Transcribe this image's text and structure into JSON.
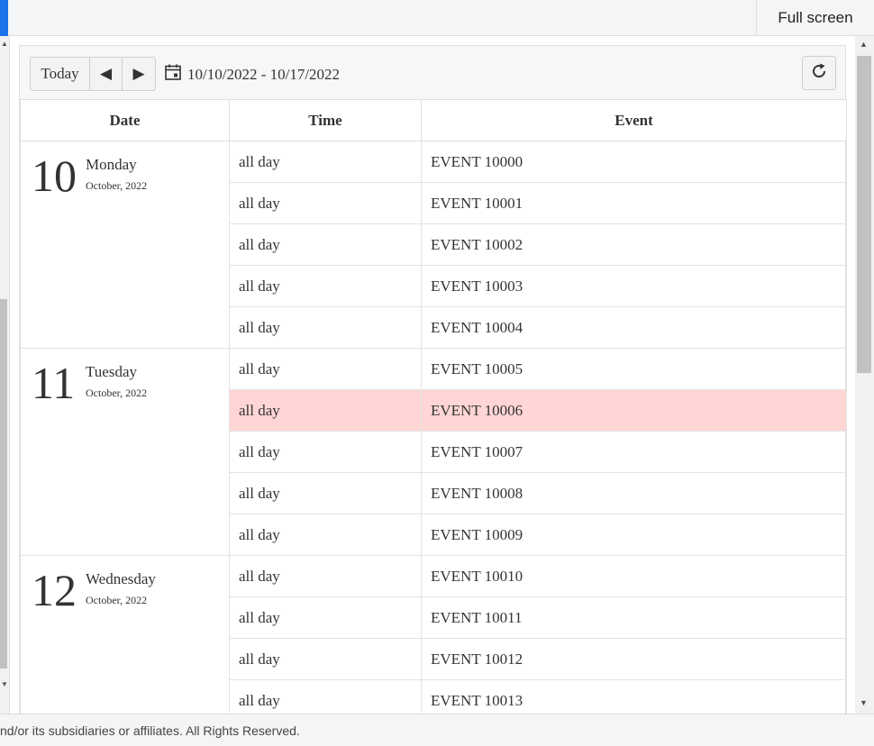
{
  "header": {
    "fullscreen_label": "Full screen"
  },
  "toolbar": {
    "today_label": "Today",
    "prev_icon": "◀",
    "next_icon": "▶",
    "date_range": "10/10/2022 - 10/17/2022"
  },
  "table": {
    "columns": [
      "Date",
      "Time",
      "Event"
    ],
    "days": [
      {
        "day": "10",
        "weekday": "Monday",
        "month_year": "October, 2022",
        "events": [
          {
            "time": "all day",
            "title": "EVENT 10000"
          },
          {
            "time": "all day",
            "title": "EVENT 10001"
          },
          {
            "time": "all day",
            "title": "EVENT 10002"
          },
          {
            "time": "all day",
            "title": "EVENT 10003"
          },
          {
            "time": "all day",
            "title": "EVENT 10004"
          }
        ]
      },
      {
        "day": "11",
        "weekday": "Tuesday",
        "month_year": "October, 2022",
        "events": [
          {
            "time": "all day",
            "title": "EVENT 10005"
          },
          {
            "time": "all day",
            "title": "EVENT 10006",
            "selected": true
          },
          {
            "time": "all day",
            "title": "EVENT 10007"
          },
          {
            "time": "all day",
            "title": "EVENT 10008"
          },
          {
            "time": "all day",
            "title": "EVENT 10009"
          }
        ]
      },
      {
        "day": "12",
        "weekday": "Wednesday",
        "month_year": "October, 2022",
        "events": [
          {
            "time": "all day",
            "title": "EVENT 10010"
          },
          {
            "time": "all day",
            "title": "EVENT 10011"
          },
          {
            "time": "all day",
            "title": "EVENT 10012"
          },
          {
            "time": "all day",
            "title": "EVENT 10013"
          }
        ]
      }
    ]
  },
  "colors": {
    "selected_row": "#ffd6d5",
    "accent": "#1a73e8"
  },
  "footer": {
    "text": "nd/or its subsidiaries or affiliates. All Rights Reserved."
  }
}
